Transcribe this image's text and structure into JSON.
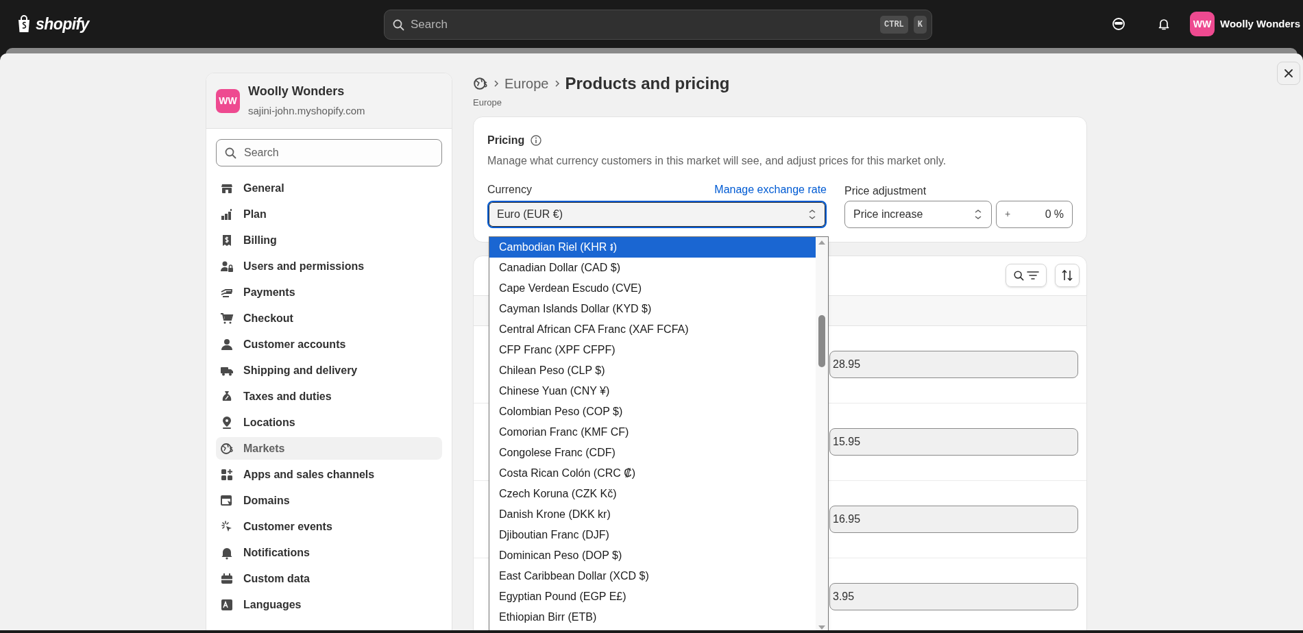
{
  "top_bar": {
    "logo": "shopify",
    "search": {
      "placeholder": "Search"
    },
    "shortcut_keys": [
      "CTRL",
      "K"
    ],
    "store": {
      "initials": "WW",
      "name": "Woolly Wonders"
    }
  },
  "sidebar": {
    "store": {
      "initials": "WW",
      "name": "Woolly Wonders",
      "domain": "sajini-john.myshopify.com"
    },
    "search": {
      "placeholder": "Search"
    },
    "items": [
      {
        "label": "General",
        "selected": false
      },
      {
        "label": "Plan",
        "selected": false
      },
      {
        "label": "Billing",
        "selected": false
      },
      {
        "label": "Users and permissions",
        "selected": false
      },
      {
        "label": "Payments",
        "selected": false
      },
      {
        "label": "Checkout",
        "selected": false
      },
      {
        "label": "Customer accounts",
        "selected": false
      },
      {
        "label": "Shipping and delivery",
        "selected": false
      },
      {
        "label": "Taxes and duties",
        "selected": false
      },
      {
        "label": "Locations",
        "selected": false
      },
      {
        "label": "Markets",
        "selected": true
      },
      {
        "label": "Apps and sales channels",
        "selected": false
      },
      {
        "label": "Domains",
        "selected": false
      },
      {
        "label": "Customer events",
        "selected": false
      },
      {
        "label": "Notifications",
        "selected": false
      },
      {
        "label": "Custom data",
        "selected": false
      },
      {
        "label": "Languages",
        "selected": false
      }
    ]
  },
  "header": {
    "breadcrumb": [
      "Europe"
    ],
    "title": "Products and pricing",
    "subtitle": "Europe"
  },
  "pricing": {
    "title": "Pricing",
    "description": "Manage what currency customers in this market will see, and adjust prices for this market only.",
    "currency": {
      "label": "Currency",
      "link": "Manage exchange rate",
      "value": "Euro (EUR €)"
    },
    "price_adjustment": {
      "label": "Price adjustment",
      "value": "Price increase",
      "sign": "+",
      "amount": "0",
      "unit": "%"
    }
  },
  "currency_dropdown": {
    "options": [
      {
        "label": "Cambodian Riel (KHR ៛)",
        "selected": true
      },
      {
        "label": "Canadian Dollar (CAD $)",
        "selected": false
      },
      {
        "label": "Cape Verdean Escudo (CVE)",
        "selected": false
      },
      {
        "label": "Cayman Islands Dollar (KYD $)",
        "selected": false
      },
      {
        "label": "Central African CFA Franc (XAF FCFA)",
        "selected": false
      },
      {
        "label": "CFP Franc (XPF CFPF)",
        "selected": false
      },
      {
        "label": "Chilean Peso (CLP $)",
        "selected": false
      },
      {
        "label": "Chinese Yuan (CNY ¥)",
        "selected": false
      },
      {
        "label": "Colombian Peso (COP $)",
        "selected": false
      },
      {
        "label": "Comorian Franc (KMF CF)",
        "selected": false
      },
      {
        "label": "Congolese Franc (CDF)",
        "selected": false
      },
      {
        "label": "Costa Rican Colón (CRC ₡)",
        "selected": false
      },
      {
        "label": "Czech Koruna (CZK Kč)",
        "selected": false
      },
      {
        "label": "Danish Krone (DKK kr)",
        "selected": false
      },
      {
        "label": "Djiboutian Franc (DJF)",
        "selected": false
      },
      {
        "label": "Dominican Peso (DOP $)",
        "selected": false
      },
      {
        "label": "East Caribbean Dollar (XCD $)",
        "selected": false
      },
      {
        "label": "Egyptian Pound (EGP E£)",
        "selected": false
      },
      {
        "label": "Ethiopian Birr (ETB)",
        "selected": false
      }
    ]
  },
  "products": {
    "prices": [
      "28.95",
      "15.95",
      "16.95",
      "3.95"
    ]
  }
}
